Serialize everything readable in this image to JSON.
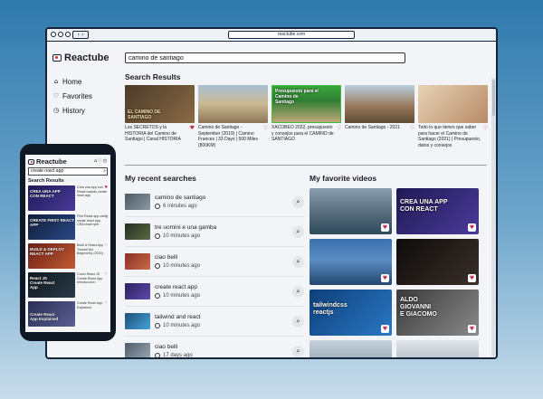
{
  "browser": {
    "url": "reactube.com",
    "nav": "‹ ›"
  },
  "app": {
    "name": "Reactube"
  },
  "search": {
    "value": "camino de santiago"
  },
  "sidebar": {
    "items": [
      {
        "label": "Home",
        "icon": "home-icon"
      },
      {
        "label": "Favorites",
        "icon": "heart-icon"
      },
      {
        "label": "History",
        "icon": "clock-icon"
      }
    ]
  },
  "sections": {
    "results": "Search Results",
    "recent": "My recent searches",
    "favorites": "My favorite videos"
  },
  "results": [
    {
      "title": "Los SECRETOS y la HISTORIA del Camino de Santiago | Canal HISTORIA",
      "thumb_text": "EL CAMINO DE\nSANTIAGO",
      "color": "#7b5a3a"
    },
    {
      "title": "Camino de Santiago - September (2019) | Camino Frances | 33 Days | 500 Miles (800KM)",
      "thumb_text": "",
      "color": "#a99574"
    },
    {
      "title": "XACOBEO 2022, presupuesto y consejos para el CAMINO de SANTIAGO",
      "thumb_text": "Presupuesto para el\nCamino de\nSantiago",
      "color": "#3f8d3a"
    },
    {
      "title": "Camino de Santiago - 2021",
      "thumb_text": "",
      "color": "#8b6c58"
    },
    {
      "title": "Todo lo que tienes que saber para hacer el Camino de Santiago (2021) | Presupuesto, datos y consejos",
      "thumb_text": "",
      "color": "#c7a07c"
    }
  ],
  "recent": [
    {
      "term": "camino de santiago",
      "time": "6 minutes ago",
      "color": "#6b7a86"
    },
    {
      "term": "tre uomini e una gamba",
      "time": "10 minutes ago",
      "color": "#34402f"
    },
    {
      "term": "ciao belli",
      "time": "10 minutes ago",
      "color": "#a3443a"
    },
    {
      "term": "create react app",
      "time": "10 minutes ago",
      "color": "#3c2f6e"
    },
    {
      "term": "tailwind and react",
      "time": "10 minutes ago",
      "color": "#2d5e86"
    },
    {
      "term": "ciao belli",
      "time": "17 days ago",
      "color": "#6a7a8a"
    }
  ],
  "favorites": [
    {
      "text": "",
      "color": "#4c5f70"
    },
    {
      "text": "CREA UNA APP\nCON REACT",
      "color": "#2c236a"
    },
    {
      "text": "",
      "color": "#2f5f98"
    },
    {
      "text": "",
      "color": "#1d1a18"
    },
    {
      "text": "tailwindcss\nreactjs",
      "color": "#1a5aa2"
    },
    {
      "text": "ALDO\nGIOVANNI\nE GIACOMO",
      "color": "#5a5a5a"
    },
    {
      "text": "",
      "color": "#7a8896"
    },
    {
      "text": "",
      "color": "#a0a8b0"
    }
  ],
  "phone": {
    "search_value": "create react app",
    "items": [
      {
        "thumb_text": "CREA UNA APP\nCON REACT",
        "info": "Crea una app con React usando create react app",
        "color": "#2c236a"
      },
      {
        "thumb_text": "CREATE FIRST REACT APP",
        "info": "First React app using create react app CRA react npm",
        "color": "#1c2f57"
      },
      {
        "thumb_text": "BUILD & DEPLOY REACT APP",
        "info": "Build & React App Tutorial (for Beginners) (2020)",
        "color": "#8a2e22"
      },
      {
        "thumb_text": "React JS\nCreate React\nApp",
        "info": "Curso React JS Create React App Introduccion",
        "color": "#18242f"
      },
      {
        "thumb_text": "Create React\nApp Explained",
        "info": "Create React App Explained",
        "color": "#3a3f66"
      }
    ]
  }
}
